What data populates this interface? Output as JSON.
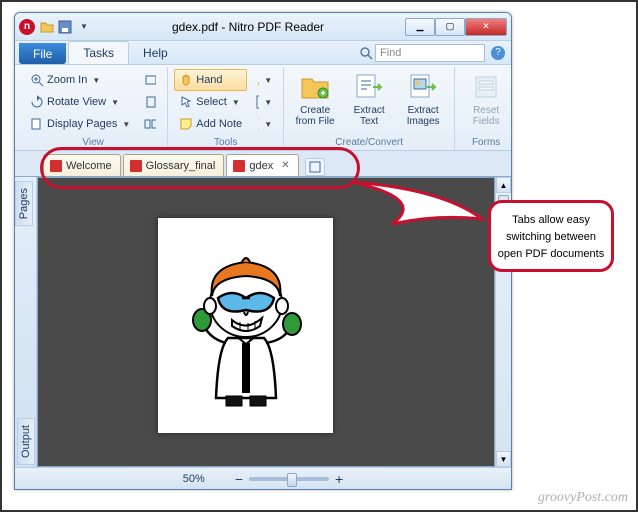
{
  "window": {
    "title": "gdex.pdf - Nitro PDF Reader",
    "controls": {
      "min": "▁",
      "max": "▢",
      "close": "✕"
    }
  },
  "menu": {
    "file": "File",
    "tabs": [
      "Tasks",
      "Help"
    ],
    "active_tab": 0,
    "find_placeholder": "Find",
    "help_icon": "?"
  },
  "ribbon": {
    "groups": [
      {
        "label": "View",
        "items": [
          {
            "label": "Zoom In",
            "icon": "zoom-in"
          },
          {
            "label": "Rotate View",
            "icon": "rotate"
          },
          {
            "label": "Display Pages",
            "icon": "display-pages"
          }
        ]
      },
      {
        "label": "Tools",
        "items": [
          {
            "label": "Hand",
            "icon": "hand",
            "selected": true
          },
          {
            "label": "Select",
            "icon": "select"
          },
          {
            "label": "Add Note",
            "icon": "note"
          }
        ]
      },
      {
        "label": "Create/Convert",
        "big_items": [
          {
            "label": "Create from File",
            "icon": "create"
          },
          {
            "label": "Extract Text",
            "icon": "extract-text"
          },
          {
            "label": "Extract Images",
            "icon": "extract-img"
          }
        ]
      },
      {
        "label": "Forms",
        "big_items": [
          {
            "label": "Reset Fields",
            "icon": "reset",
            "disabled": true
          }
        ]
      }
    ]
  },
  "doc_tabs": {
    "items": [
      "Welcome",
      "Glossary_final",
      "gdex"
    ],
    "active": 2,
    "new_tab": "+"
  },
  "side_panels": {
    "left_top": "Pages",
    "left_bottom": "Output"
  },
  "status": {
    "zoom": "50%",
    "minus": "−",
    "plus": "+"
  },
  "annotation": {
    "callout_text": "Tabs allow easy switching between open PDF documents"
  },
  "watermark": "groovyPost.com"
}
